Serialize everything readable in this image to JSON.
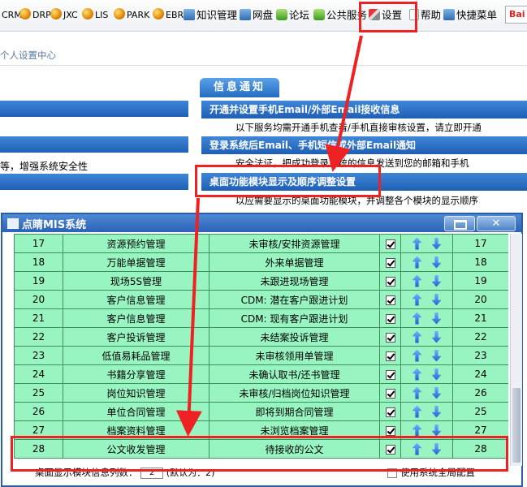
{
  "toolbar": {
    "items": [
      {
        "label": "CRM",
        "icon": "globe-icon"
      },
      {
        "label": "DRP",
        "icon": "globe-icon"
      },
      {
        "label": "JXC",
        "icon": "globe-icon"
      },
      {
        "label": "LIS",
        "icon": "globe-icon"
      },
      {
        "label": "PARK",
        "icon": "globe-icon"
      },
      {
        "label": "EBR",
        "icon": "globe-icon"
      },
      {
        "label": "知识管理",
        "icon": "knowledge-icon"
      },
      {
        "label": "网盘",
        "icon": "disk-icon"
      },
      {
        "label": "论坛",
        "icon": "forum-icon"
      },
      {
        "label": "公共服务",
        "icon": "public-service-icon"
      },
      {
        "label": "设置",
        "icon": "tools-icon"
      },
      {
        "label": "帮助",
        "icon": "help-icon"
      },
      {
        "label": "快捷菜单",
        "icon": "shortcut-menu-icon"
      }
    ],
    "search_logo": "Bai"
  },
  "page": {
    "breadcrumb": "个人设置中心",
    "left_text": "等，增强系统安全性",
    "info_tab": "信息通知",
    "sections": [
      {
        "title": "开通并设置手机Email/外部Email接收信息",
        "desc": "以下服务均需开通手机查看/手机直接审核设置，请立即开通"
      },
      {
        "title": "登录系统后Email、手机短信或外部Email通知",
        "desc": "安全法证，把成功登录系统的信息发送到您的邮箱和手机"
      },
      {
        "title": "桌面功能模块显示及顺序调整设置",
        "desc": "以应需要显示的桌面功能模块，并调整各个模块的显示顺序"
      }
    ]
  },
  "dialog": {
    "title": "点睛MIS系统",
    "close_label": "✕",
    "rows": [
      {
        "no": "17",
        "name": "资源预约管理",
        "desc": "未审核/安排资源管理",
        "checked": true,
        "order": "17"
      },
      {
        "no": "18",
        "name": "万能单据管理",
        "desc": "外来单据管理",
        "checked": true,
        "order": "18"
      },
      {
        "no": "19",
        "name": "现场5S管理",
        "desc": "未跟进现场管理",
        "checked": true,
        "order": "19"
      },
      {
        "no": "20",
        "name": "客户信息管理",
        "desc": "CDM: 潜在客户跟进计划",
        "checked": true,
        "order": "20"
      },
      {
        "no": "21",
        "name": "客户信息管理",
        "desc": "CDM: 现有客户跟进计划",
        "checked": true,
        "order": "21"
      },
      {
        "no": "22",
        "name": "客户投诉管理",
        "desc": "未结案投诉管理",
        "checked": true,
        "order": "22"
      },
      {
        "no": "23",
        "name": "低值易耗品管理",
        "desc": "未审核领用单管理",
        "checked": true,
        "order": "23"
      },
      {
        "no": "24",
        "name": "书籍分享管理",
        "desc": "未确认取书/还书管理",
        "checked": true,
        "order": "24"
      },
      {
        "no": "25",
        "name": "岗位知识管理",
        "desc": "未审核/归档岗位知识管理",
        "checked": true,
        "order": "26"
      },
      {
        "no": "26",
        "name": "单位合同管理",
        "desc": "即将到期合同管理",
        "checked": true,
        "order": "25"
      },
      {
        "no": "27",
        "name": "档案资料管理",
        "desc": "未浏览档案管理",
        "checked": true,
        "order": "27"
      },
      {
        "no": "28",
        "name": "公文收发管理",
        "desc": "待接收的公文",
        "checked": true,
        "order": "28"
      }
    ],
    "footer": {
      "cols_label": "桌面显示模块信息列数：",
      "cols_value": "2",
      "default_label": "(默认为：2)",
      "sys_default_label": "使用系统全局配置"
    }
  },
  "colors": {
    "highlight": "#ee2222",
    "table_bg": "#98f5c2",
    "bar_blue": "#2a6cc4"
  }
}
